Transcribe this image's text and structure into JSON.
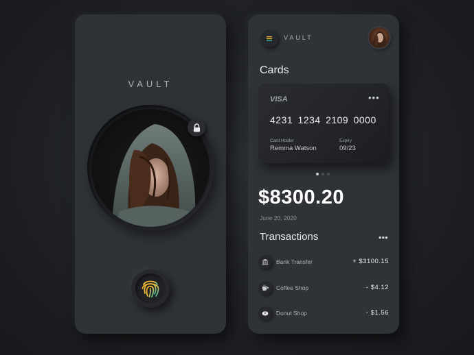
{
  "left_screen": {
    "title": "VAULT",
    "icons": {
      "lock": "lock-icon",
      "fingerprint": "fingerprint-icon"
    }
  },
  "right_screen": {
    "header": {
      "brand": "VAULT",
      "menu_icon": "menu-icon"
    },
    "cards_heading": "Cards",
    "card": {
      "brand": "VISA",
      "more": "•••",
      "number": "4231 1234 2109 0000",
      "holder_label": "Card Holder",
      "holder_name": "Remma Watson",
      "expiry_label": "Expiry",
      "expiry": "09/23"
    },
    "carousel": {
      "pages": 3,
      "active": 1
    },
    "balance": {
      "amount": "$8300.20",
      "date": "June 20, 2020"
    },
    "transactions": {
      "heading": "Transactions",
      "more": "•••",
      "items": [
        {
          "icon": "bank-icon",
          "name": "Bank Transfer",
          "amount": "+ $3100.15"
        },
        {
          "icon": "coffee-icon",
          "name": "Coffee Shop",
          "amount": "- $4.12"
        },
        {
          "icon": "donut-icon",
          "name": "Donut Shop",
          "amount": "- $1.56"
        }
      ]
    }
  },
  "colors": {
    "background": "#1e2024",
    "panel": "#2f3237",
    "text_primary": "#e8eaed",
    "text_secondary": "#8e939a",
    "fingerprint_gradient": [
      "#f5a623",
      "#e8c547",
      "#3fb6a0"
    ]
  }
}
